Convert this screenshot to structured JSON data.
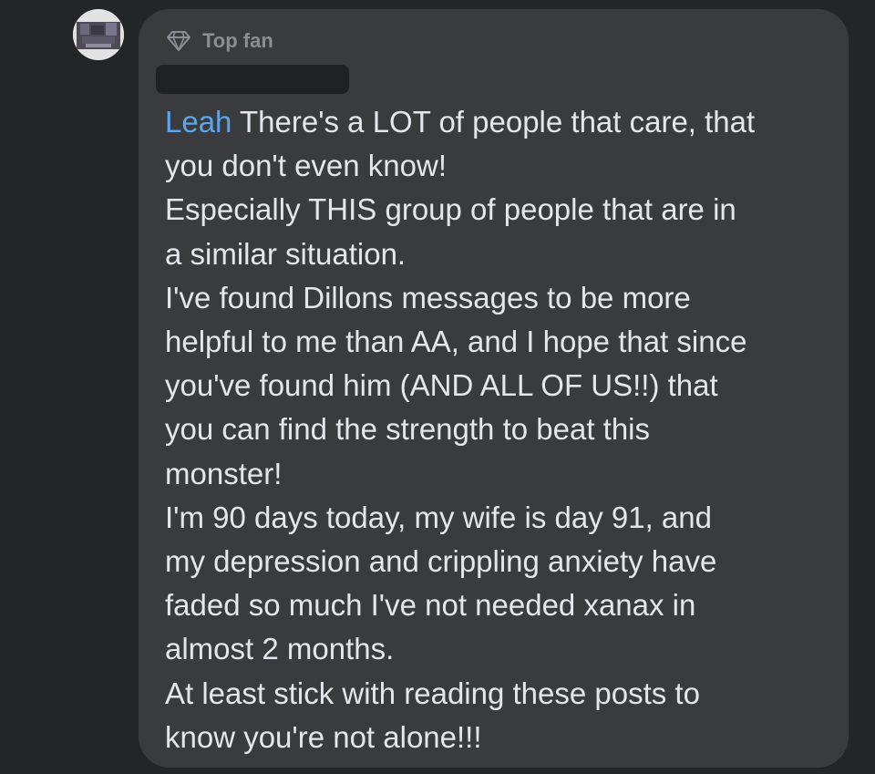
{
  "comment": {
    "badge_label": "Top fan",
    "badge_icon": "diamond-icon",
    "mention": "Leah",
    "mention_color": "#5aa7f0",
    "text_color": "#e4e6eb",
    "bubble_color": "#3a3b3c",
    "background_color": "#242526",
    "lines": [
      " There's a LOT of people that care, that",
      "you don't even know!",
      "Especially THIS group of people that are in",
      "a similar situation.",
      "I've found Dillons messages to be more",
      "helpful to me than AA, and I hope that since",
      "you've found him (AND ALL OF US!!) that",
      "you can find the strength to beat this",
      "monster!",
      "I'm 90 days today, my wife is day 91, and",
      "my depression and crippling anxiety have",
      "faded so much I've not needed xanax in",
      "almost 2 months.",
      "At least stick with reading these posts to",
      "know you're not alone!!!"
    ]
  }
}
